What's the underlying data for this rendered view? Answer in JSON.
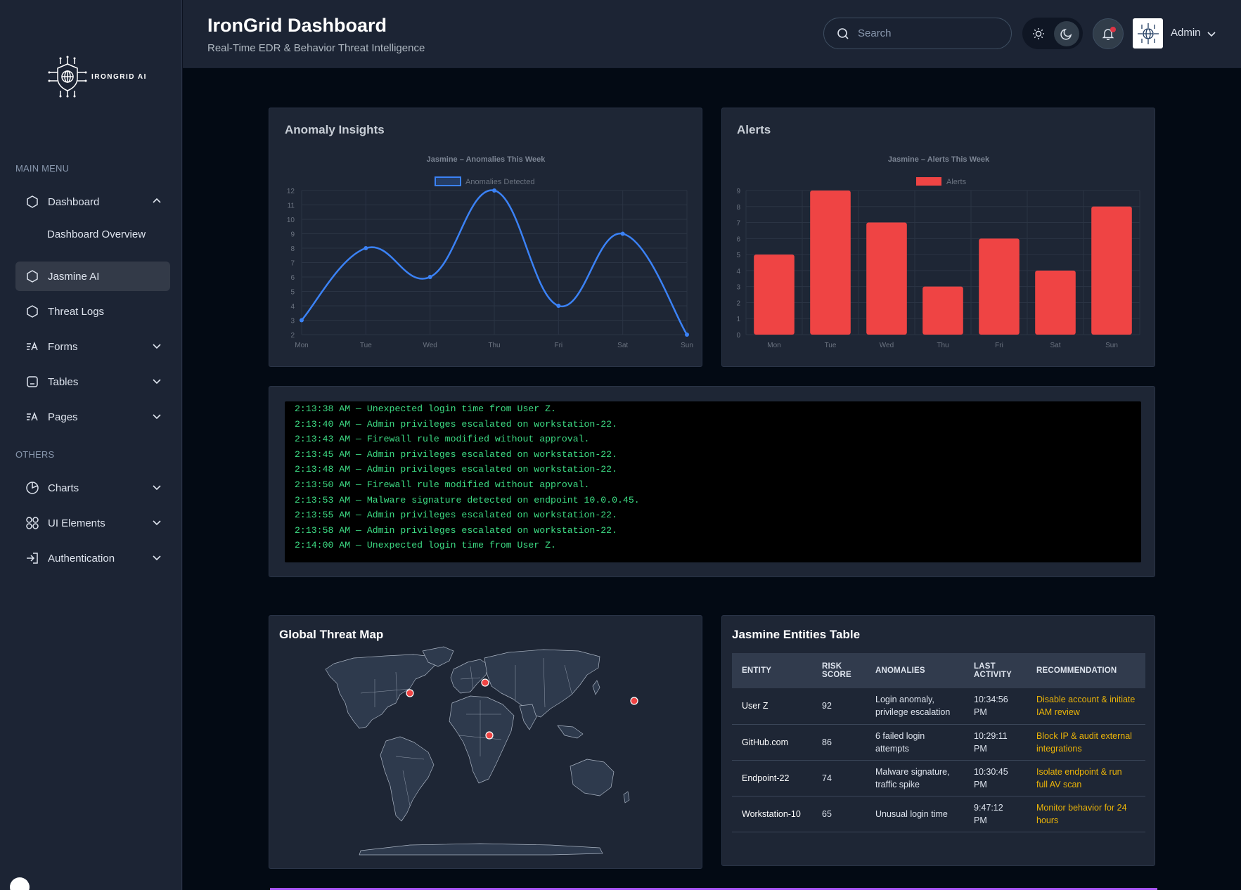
{
  "app": {
    "logo_text": "IRONGRID AI",
    "title": "IronGrid Dashboard",
    "subtitle": "Real-Time EDR & Behavior Threat Intelligence"
  },
  "header": {
    "search_placeholder": "Search",
    "user_name": "Admin",
    "icons": [
      "search-icon",
      "sun-icon",
      "moon-icon",
      "bell-icon",
      "chevron-down-icon"
    ]
  },
  "sidebar": {
    "main_heading": "MAIN MENU",
    "others_heading": "OTHERS",
    "main_items": [
      {
        "label": "Dashboard",
        "icon": "dashboard-icon",
        "expanded": true
      },
      {
        "label": "Jasmine AI",
        "icon": "ai-icon",
        "active": true
      },
      {
        "label": "Threat Logs",
        "icon": "logs-icon"
      },
      {
        "label": "Forms",
        "icon": "forms-icon"
      },
      {
        "label": "Tables",
        "icon": "tables-icon"
      },
      {
        "label": "Pages",
        "icon": "pages-icon"
      }
    ],
    "dashboard_sub": "Dashboard Overview",
    "other_items": [
      {
        "label": "Charts",
        "icon": "pie-chart-icon"
      },
      {
        "label": "UI Elements",
        "icon": "grid-icon"
      },
      {
        "label": "Authentication",
        "icon": "login-icon"
      }
    ]
  },
  "anomaly_card": {
    "title": "Anomaly Insights"
  },
  "alerts_card": {
    "title": "Alerts"
  },
  "chart_data": [
    {
      "type": "line",
      "title": "Jasmine – Anomalies This Week",
      "categories": [
        "Mon",
        "Tue",
        "Wed",
        "Thu",
        "Fri",
        "Sat",
        "Sun"
      ],
      "series": [
        {
          "name": "Anomalies Detected",
          "values": [
            3,
            8,
            6,
            12,
            4,
            9,
            2
          ]
        }
      ],
      "ylim": [
        2,
        12
      ],
      "yticks": [
        2,
        3,
        4,
        5,
        6,
        7,
        8,
        9,
        10,
        11,
        12
      ],
      "color": "#3b82f6",
      "grid": true,
      "legend": "top-center"
    },
    {
      "type": "bar",
      "title": "Jasmine – Alerts This Week",
      "categories": [
        "Mon",
        "Tue",
        "Wed",
        "Thu",
        "Fri",
        "Sat",
        "Sun"
      ],
      "series": [
        {
          "name": "Alerts",
          "values": [
            5,
            9,
            7,
            3,
            6,
            4,
            8
          ]
        }
      ],
      "ylim": [
        0,
        9
      ],
      "yticks": [
        0,
        1,
        2,
        3,
        4,
        5,
        6,
        7,
        8,
        9
      ],
      "color": "#ef4444",
      "grid": true,
      "legend": "top-center"
    }
  ],
  "console": {
    "lines": [
      "2:13:38 AM — Unexpected login time from User Z.",
      "2:13:40 AM — Admin privileges escalated on workstation-22.",
      "2:13:43 AM — Firewall rule modified without approval.",
      "2:13:45 AM — Admin privileges escalated on workstation-22.",
      "2:13:48 AM — Admin privileges escalated on workstation-22.",
      "2:13:50 AM — Firewall rule modified without approval.",
      "2:13:53 AM — Malware signature detected on endpoint 10.0.0.45.",
      "2:13:55 AM — Admin privileges escalated on workstation-22.",
      "2:13:58 AM — Admin privileges escalated on workstation-22.",
      "2:14:00 AM — Unexpected login time from User Z."
    ]
  },
  "map_card": {
    "title": "Global Threat Map",
    "marker_color": "#ef4444"
  },
  "entities_table": {
    "title": "Jasmine Entities Table",
    "headers": [
      "ENTITY",
      "RISK SCORE",
      "ANOMALIES",
      "LAST ACTIVITY",
      "RECOMMENDATION"
    ],
    "rows": [
      {
        "entity": "User Z",
        "risk": "92",
        "anomalies": "Login anomaly, privilege escalation",
        "last": "10:34:56 PM",
        "rec": "Disable account & initiate IAM review"
      },
      {
        "entity": "GitHub.com",
        "risk": "86",
        "anomalies": "6 failed login attempts",
        "last": "10:29:11 PM",
        "rec": "Block IP & audit external integrations"
      },
      {
        "entity": "Endpoint-22",
        "risk": "74",
        "anomalies": "Malware signature, traffic spike",
        "last": "10:30:45 PM",
        "rec": "Isolate endpoint & run full AV scan"
      },
      {
        "entity": "Workstation-10",
        "risk": "65",
        "anomalies": "Unusual login time",
        "last": "9:47:12 PM",
        "rec": "Monitor behavior for 24 hours"
      }
    ]
  }
}
